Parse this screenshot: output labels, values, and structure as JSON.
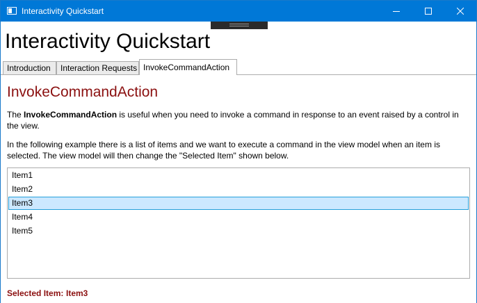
{
  "window": {
    "title": "Interactivity Quickstart",
    "accent_color": "#0078d7",
    "buttons": {
      "minimize_icon": "minimize-icon",
      "maximize_icon": "maximize-icon",
      "close_icon": "close-icon"
    }
  },
  "header": {
    "title": "Interactivity Quickstart"
  },
  "tabs": [
    {
      "label": "Introduction",
      "selected": false
    },
    {
      "label": "Interaction Requests",
      "selected": false
    },
    {
      "label": "InvokeCommandAction",
      "selected": true
    }
  ],
  "content": {
    "heading": "InvokeCommandAction",
    "heading_color": "#8b1010",
    "para1_prefix": "The ",
    "para1_bold": "InvokeCommandAction",
    "para1_suffix": " is useful when you need to invoke a command in response to an event raised by a control in the view.",
    "para2": "In the following example there is a list of items and we want to execute a command in the view model when an item is selected. The view model will then change the \"Selected Item\" shown below.",
    "list": {
      "items": [
        "Item1",
        "Item2",
        "Item3",
        "Item4",
        "Item5"
      ],
      "selected_item": "Item3"
    },
    "selected_label": "Selected Item:",
    "selected_value": "Item3"
  }
}
